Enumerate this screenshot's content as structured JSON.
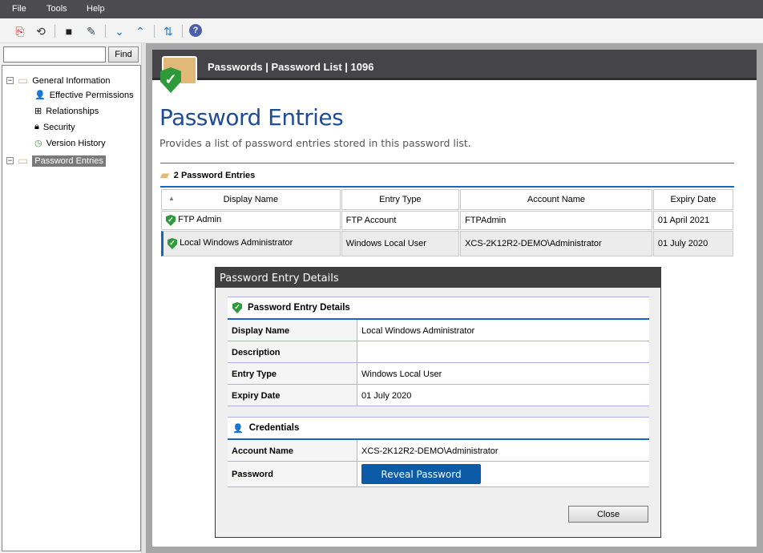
{
  "menu": [
    "File",
    "Tools",
    "Help"
  ],
  "toolbar": {
    "icons": [
      "export-pdf-icon",
      "export-icon",
      "save-icon",
      "edit-icon",
      "chevron-down-icon",
      "chevron-up-icon",
      "sync-icon",
      "help-icon"
    ],
    "help": "?"
  },
  "search": {
    "value": "",
    "find_label": "Find"
  },
  "tree": {
    "root": "General Information",
    "children": [
      "Effective Permissions",
      "Relationships",
      "Security",
      "Version History"
    ],
    "entries": "Password Entries"
  },
  "header": {
    "title": "Passwords | Password List | 1096"
  },
  "page": {
    "title": "Password Entries",
    "subtitle": "Provides a list of password entries stored in this password list.",
    "count": "2 Password Entries"
  },
  "table": {
    "columns": [
      "Display Name",
      "Entry Type",
      "Account Name",
      "Expiry Date"
    ],
    "rows": [
      [
        "FTP Admin",
        "FTP Account",
        "FTPAdmin",
        "01 April 2021"
      ],
      [
        "Local Windows Administrator",
        "Windows Local User",
        "XCS-2K12R2-DEMO\\Administrator",
        "01 July 2020"
      ]
    ],
    "selected_row": 1
  },
  "dialog": {
    "title": "Password Entry Details",
    "section1": "Password Entry Details",
    "fields": [
      {
        "label": "Display Name",
        "value": "Local Windows Administrator"
      },
      {
        "label": "Description",
        "value": ""
      },
      {
        "label": "Entry Type",
        "value": "Windows Local User"
      },
      {
        "label": "Expiry Date",
        "value": "01 July 2020"
      }
    ],
    "section2": "Credentials",
    "account_label": "Account Name",
    "account_value": "XCS-2K12R2-DEMO\\Administrator",
    "password_label": "Password",
    "reveal": "Reveal Password",
    "close": "Close"
  },
  "colors": {
    "accent": "#1566c0",
    "title": "#1f4c94",
    "button": "#0b5ba6",
    "shield": "#2e9a3a"
  }
}
